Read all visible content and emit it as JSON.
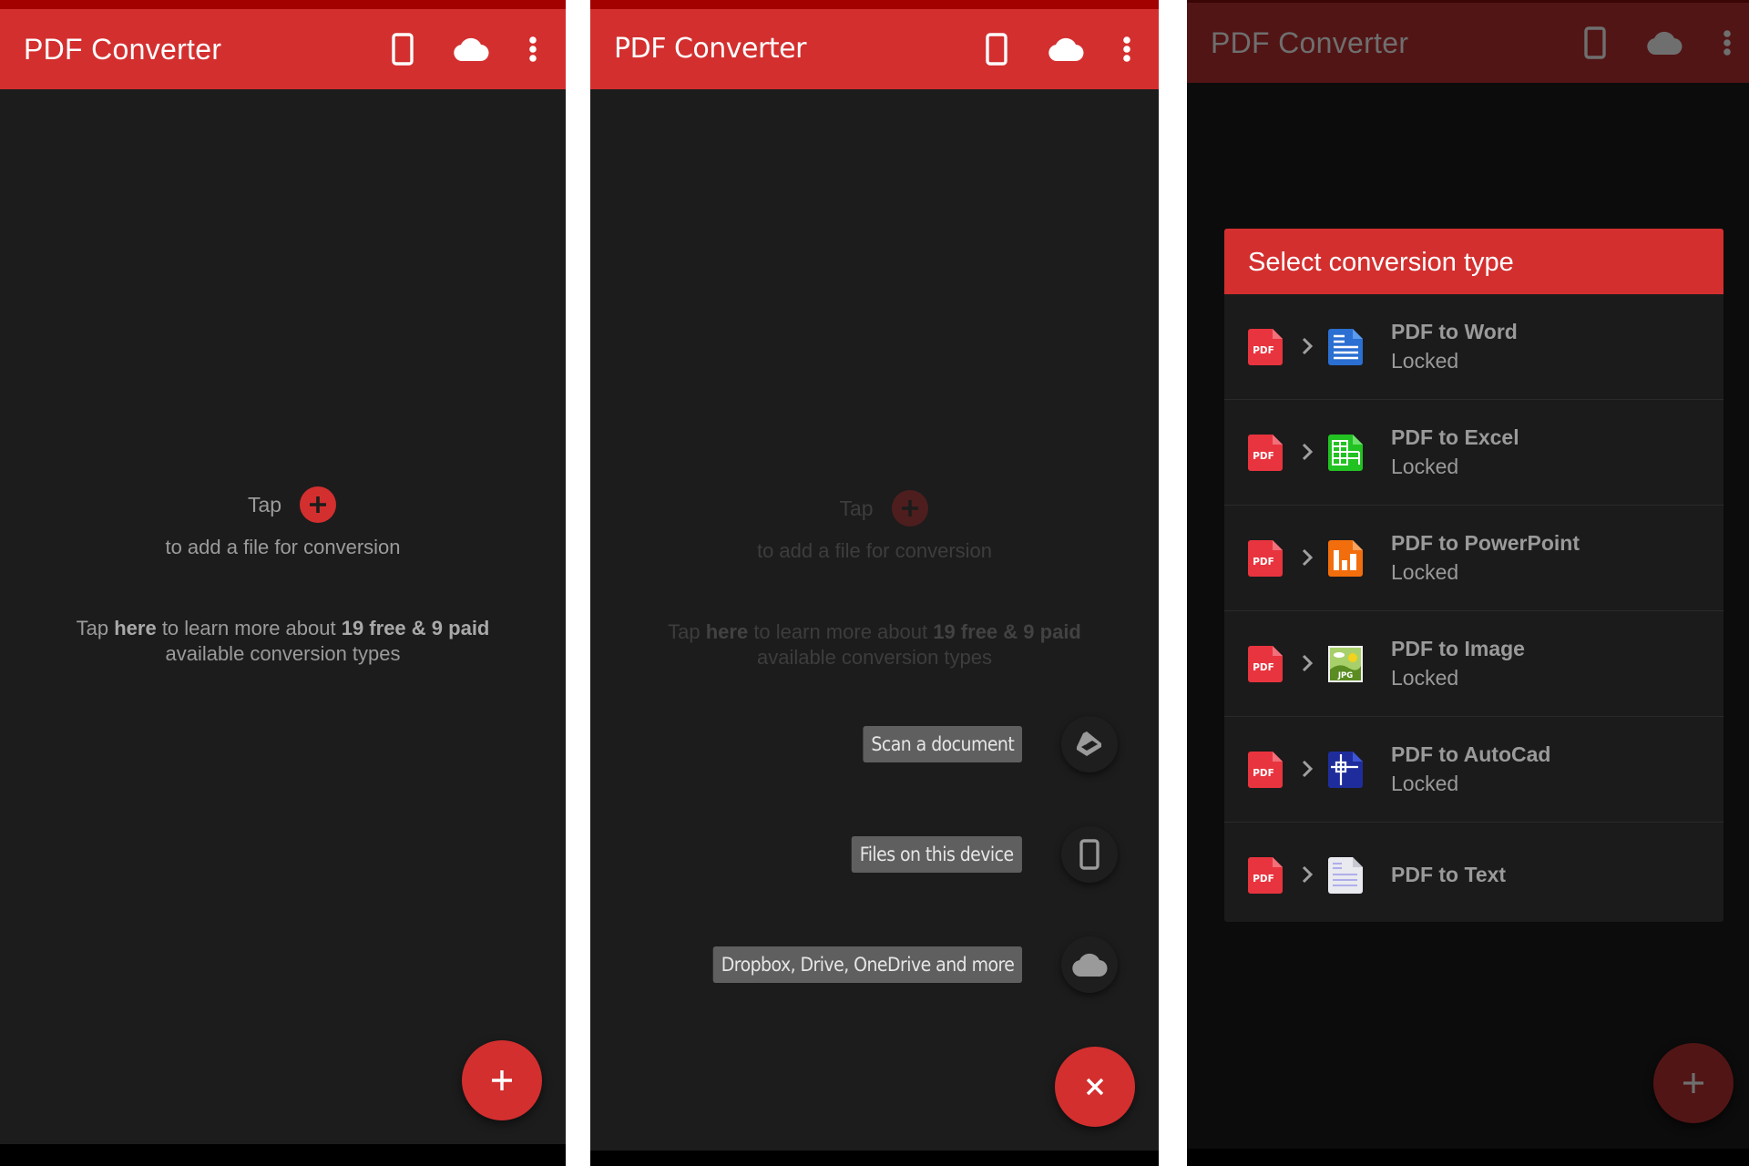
{
  "app": {
    "title": "PDF Converter",
    "actions": [
      {
        "name": "device-files",
        "icon": "phone-icon"
      },
      {
        "name": "cloud-files",
        "icon": "cloud-icon"
      },
      {
        "name": "more-options",
        "icon": "more-vert-icon"
      }
    ]
  },
  "empty_state": {
    "tap": "Tap",
    "add_hint": "to add a file for conversion",
    "learn": {
      "p1": "Tap ",
      "here": "here",
      "p2": " to learn more about ",
      "free": "19 free",
      "amp": " & ",
      "paid": "9 paid",
      "p3": " available conversion types"
    }
  },
  "fab": {
    "add_icon": "plus-icon",
    "close_icon": "close-icon"
  },
  "speed_dial": [
    {
      "label": "Scan a document",
      "icon": "scanner-icon"
    },
    {
      "label": "Files on this device",
      "icon": "phone-icon"
    },
    {
      "label": "Dropbox, Drive, OneDrive and more",
      "icon": "cloud-icon"
    }
  ],
  "dialog": {
    "title": "Select conversion type",
    "items": [
      {
        "title": "PDF to Word",
        "status": "Locked",
        "target_icon": "word-doc-icon"
      },
      {
        "title": "PDF to Excel",
        "status": "Locked",
        "target_icon": "excel-sheet-icon"
      },
      {
        "title": "PDF to PowerPoint",
        "status": "Locked",
        "target_icon": "powerpoint-icon"
      },
      {
        "title": "PDF to Image",
        "status": "Locked",
        "target_icon": "jpg-image-icon"
      },
      {
        "title": "PDF to AutoCad",
        "status": "Locked",
        "target_icon": "autocad-icon"
      },
      {
        "title": "PDF to Text",
        "status": "",
        "target_icon": "text-file-icon"
      }
    ]
  },
  "colors": {
    "brand_red": "#d32f2f",
    "status_bar": "#a30000",
    "background": "#1c1c1c",
    "word_blue": "#2a6fd1",
    "excel_green": "#21c221",
    "ppt_orange": "#f26d0c",
    "autocad_navy": "#1f2d9c"
  }
}
